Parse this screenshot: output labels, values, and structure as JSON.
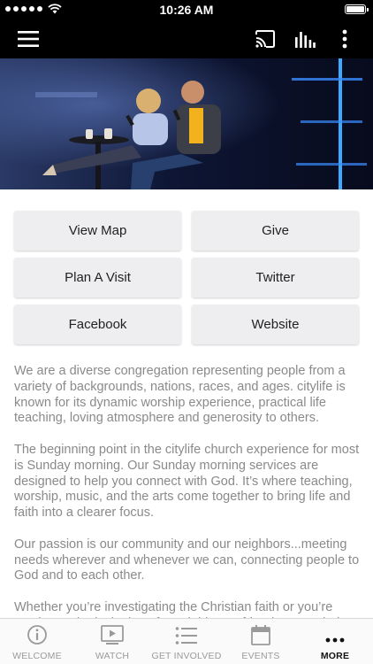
{
  "status_bar": {
    "time": "10:26 AM"
  },
  "app_bar": {
    "menu_icon": "hamburger-menu-icon",
    "cast_icon": "cast-icon",
    "audio_icon": "audio-bars-icon",
    "more_icon": "vertical-ellipsis-icon"
  },
  "hero": {
    "image_description": "two people on stage with microphones"
  },
  "buttons": [
    {
      "label": "View Map"
    },
    {
      "label": "Give"
    },
    {
      "label": "Plan A Visit"
    },
    {
      "label": "Twitter"
    },
    {
      "label": "Facebook"
    },
    {
      "label": "Website"
    }
  ],
  "description": {
    "paragraphs": [
      "We are a diverse congregation representing people from a variety of backgrounds, nations, races, and ages. citylife is known for its dynamic worship experience, practical life teaching, loving atmosphere and generosity to others.",
      "The beginning point in the citylife church experience for most is Sunday morning. Our Sunday morning services are designed to help you connect with God. It’s where teaching, worship, music, and the arts come together to bring life and faith into a clearer focus.",
      "Our passion is our community and our neighbors...meeting needs wherever and whenever we can, connecting people to God and to each other.",
      "Whether you’re investigating the Christian faith or you’re coming at the invitation of a neighbor or friend, we’re glad"
    ]
  },
  "tab_bar": {
    "tabs": [
      {
        "label": "WELCOME",
        "icon": "info-circle-icon",
        "active": false
      },
      {
        "label": "WATCH",
        "icon": "video-player-icon",
        "active": false
      },
      {
        "label": "GET INVOLVED",
        "icon": "list-icon",
        "active": false
      },
      {
        "label": "EVENTS",
        "icon": "calendar-icon",
        "active": false
      },
      {
        "label": "MORE",
        "icon": "more-dots-icon",
        "active": true
      }
    ]
  },
  "colors": {
    "bar_background": "#000000",
    "button_background": "#eeeef0",
    "text_gray": "#8a8a8a",
    "tab_inactive": "#9a9a9a",
    "tab_active": "#111111"
  }
}
